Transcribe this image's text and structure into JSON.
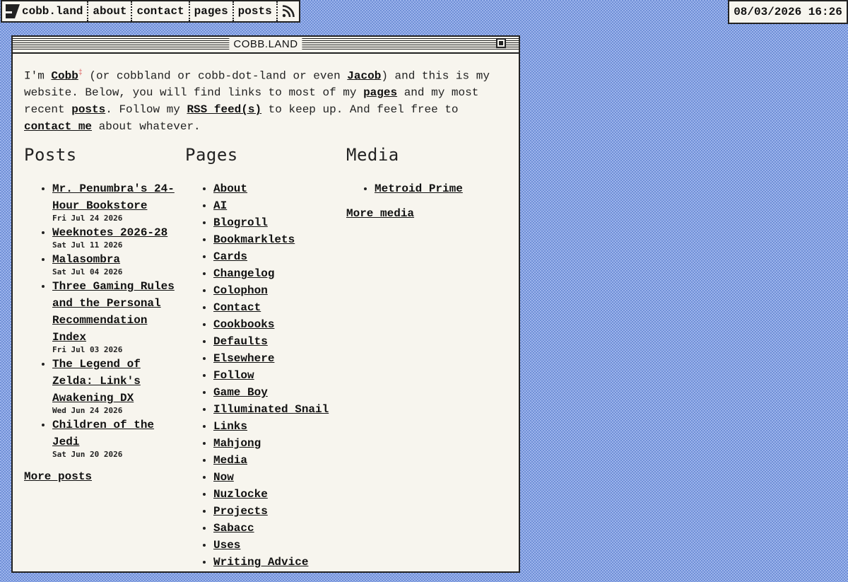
{
  "nav": {
    "site": "cobb.land",
    "links": [
      "about",
      "contact",
      "pages",
      "posts"
    ]
  },
  "clock": "08/03/2026 16:26",
  "window": {
    "title": "COBB.LAND"
  },
  "intro": {
    "p1": "I'm ",
    "cobb": "Cobb",
    "mark": "‡",
    "p2": " (or cobbland or cobb-dot-land or even ",
    "jacob": "Jacob",
    "p3": ") and this is my website. Below, you will find links to most of my ",
    "pages": "pages",
    "p4": " and my most recent ",
    "posts": "posts",
    "p5": ". Follow my ",
    "rss": "RSS feed(s)",
    "p6": " to keep up. And feel free to ",
    "contact": "contact me",
    "p7": " about whatever."
  },
  "posts": {
    "heading": "Posts",
    "items": [
      {
        "title": "Mr. Penumbra's 24-Hour Bookstore",
        "date": "Fri Jul 24 2026"
      },
      {
        "title": "Weeknotes 2026-28",
        "date": "Sat Jul 11 2026"
      },
      {
        "title": "Malasombra",
        "date": "Sat Jul 04 2026"
      },
      {
        "title": "Three Gaming Rules and the Personal Recommendation Index",
        "date": "Fri Jul 03 2026"
      },
      {
        "title": "The Legend of Zelda: Link's Awakening DX",
        "date": "Wed Jun 24 2026"
      },
      {
        "title": "Children of the Jedi",
        "date": "Sat Jun 20 2026"
      }
    ],
    "more": "More posts"
  },
  "pages": {
    "heading": "Pages",
    "items": [
      "About",
      "AI",
      "Blogroll",
      "Bookmarklets",
      "Cards",
      "Changelog",
      "Colophon",
      "Contact",
      "Cookbooks",
      "Defaults",
      "Elsewhere",
      "Follow",
      "Game Boy",
      "Illuminated Snail",
      "Links",
      "Mahjong",
      "Media",
      "Now",
      "Nuzlocke",
      "Projects",
      "Sabacc",
      "Uses",
      "Writing Advice"
    ]
  },
  "media": {
    "heading": "Media",
    "items": [
      "Metroid Prime"
    ],
    "more": "More media"
  }
}
